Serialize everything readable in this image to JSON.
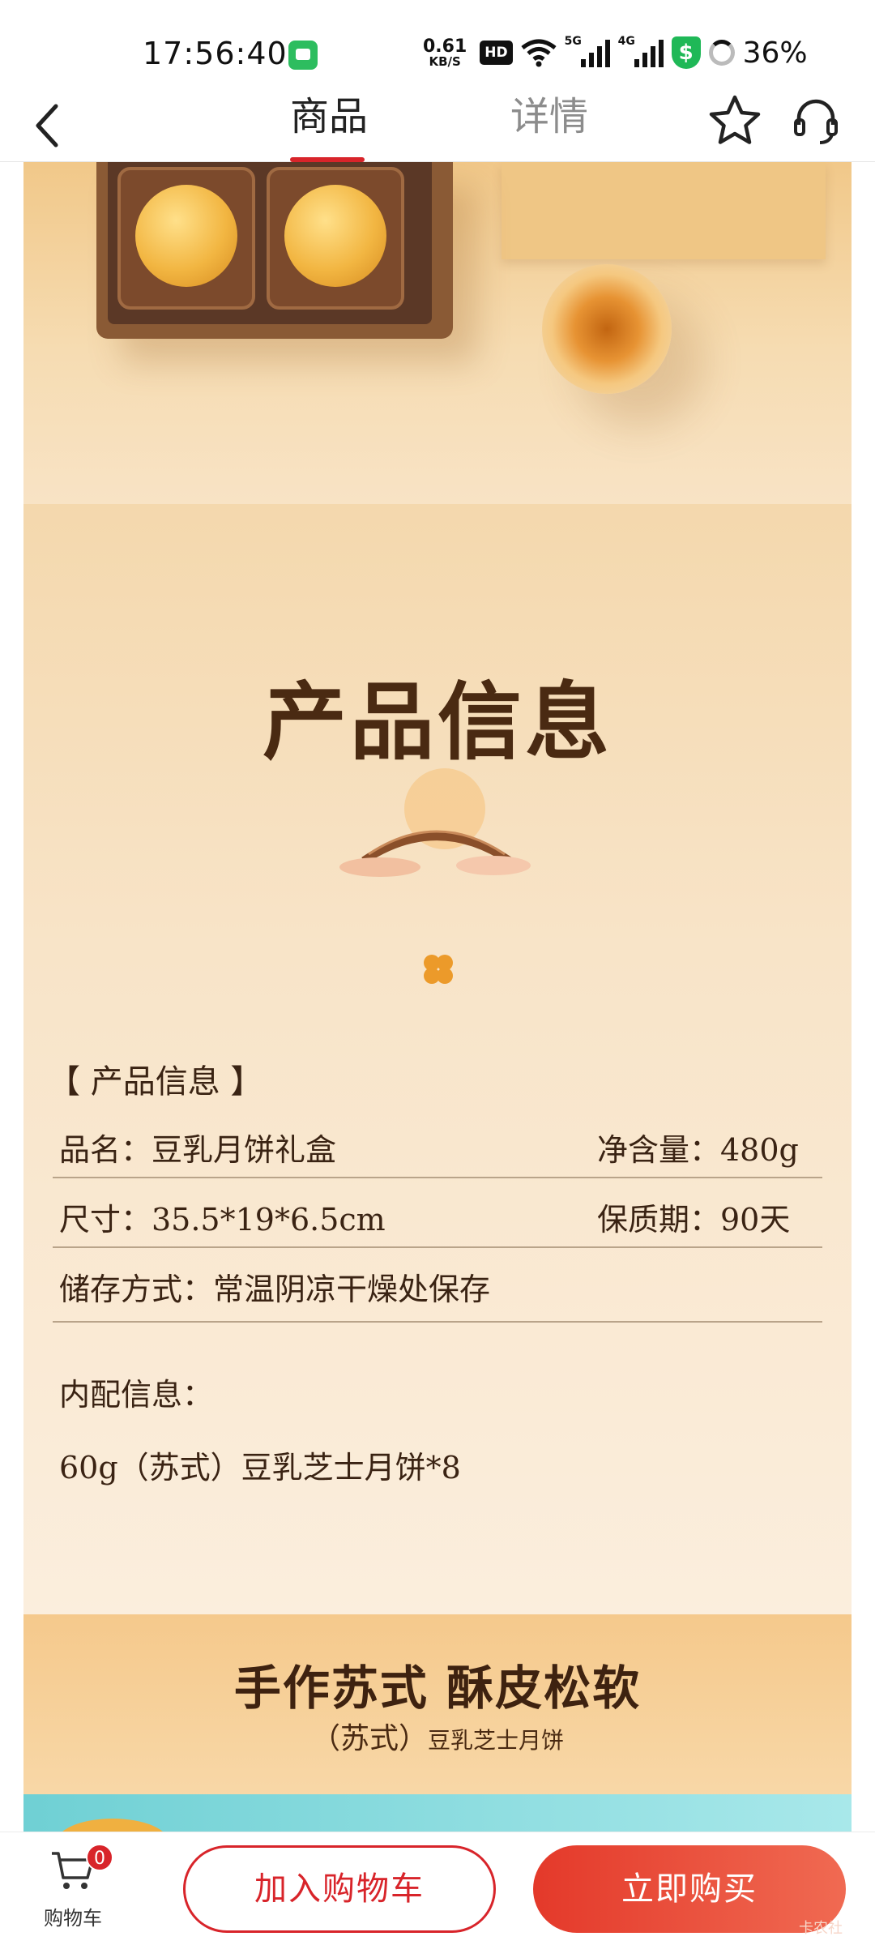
{
  "status_bar": {
    "time": "17:56:40",
    "net_speed_value": "0.61",
    "net_speed_unit": "KB/S",
    "hd_label": "HD",
    "signal1_label": "5G",
    "signal2_label": "4G",
    "battery": "36%"
  },
  "nav": {
    "tab_product": "商品",
    "tab_detail": "详情",
    "active_tab": "商品"
  },
  "info": {
    "title": "产品信息",
    "section_label": "【 产品信息 】",
    "rows": [
      {
        "left": "品名：豆乳月饼礼盒",
        "right": "净含量：480g"
      },
      {
        "left": "尺寸：35.5*19*6.5cm",
        "right": "保质期：90天"
      },
      {
        "left": "储存方式：常温阴凉干燥处保存",
        "right": ""
      }
    ],
    "contents_label": "内配信息：",
    "contents_value": "60g（苏式）豆乳芝士月饼*8"
  },
  "feature": {
    "title": "手作苏式 酥皮松软",
    "sub_prefix": "（苏式）",
    "sub_name": "豆乳芝士月饼"
  },
  "bottom_bar": {
    "cart_label": "购物车",
    "cart_count": "0",
    "add_to_cart": "加入购物车",
    "buy_now": "立即购买",
    "watermark": "卡农社"
  },
  "colors": {
    "accent": "#d8242a",
    "buy_gradient_start": "#e4392a",
    "buy_gradient_end": "#f06a52",
    "info_text": "#3a2313"
  }
}
